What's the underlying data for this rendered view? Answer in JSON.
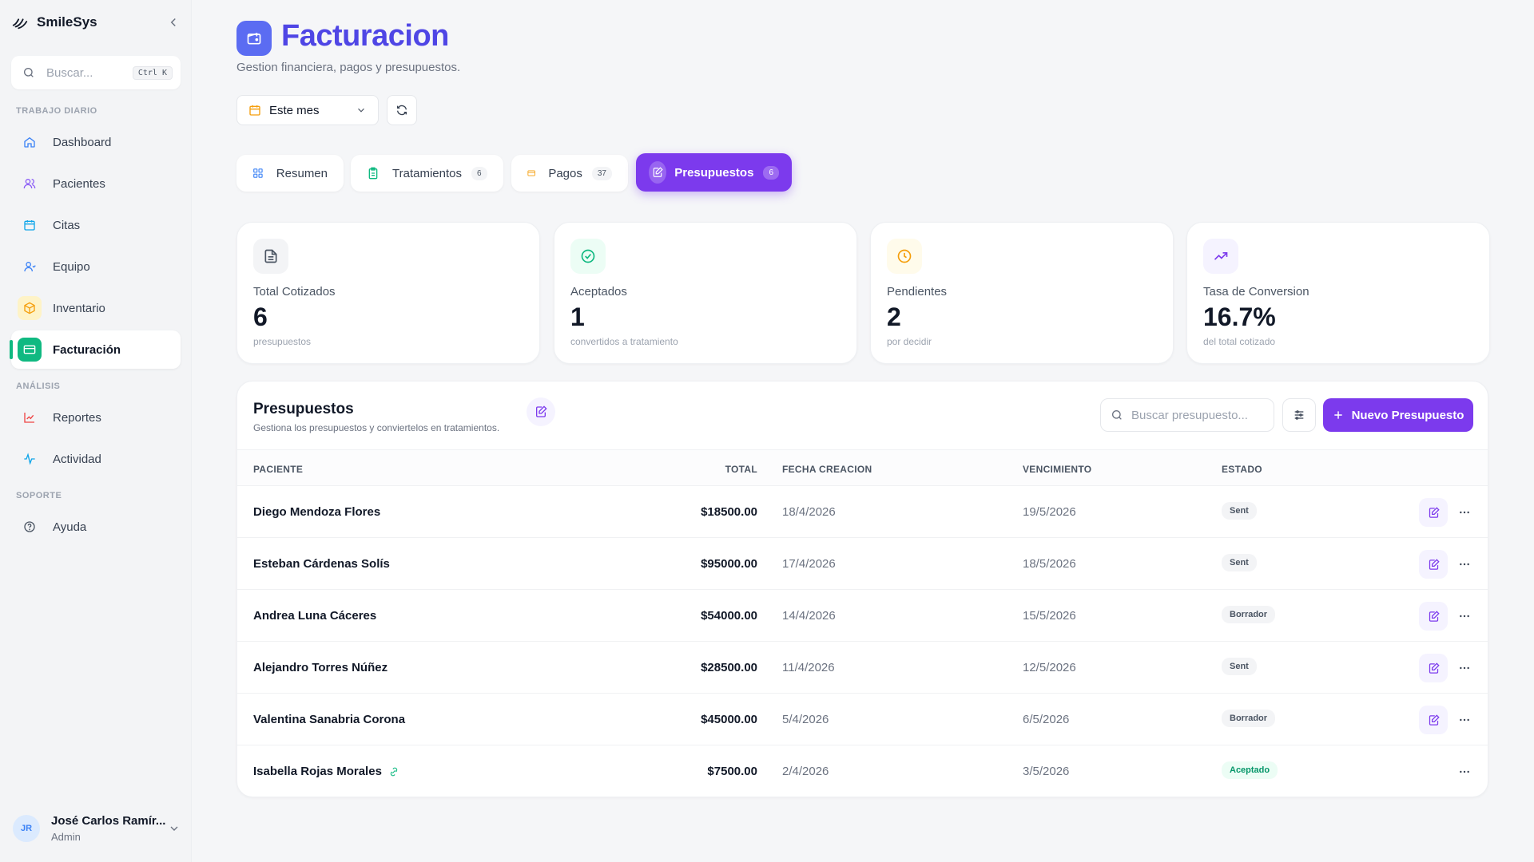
{
  "brand": {
    "name": "SmileSys"
  },
  "search": {
    "placeholder": "Buscar...",
    "shortcut": "Ctrl K"
  },
  "sidebar": {
    "sections": [
      {
        "label": "TRABAJO DIARIO"
      },
      {
        "label": "ANÁLISIS"
      },
      {
        "label": "SOPORTE"
      }
    ],
    "items": [
      {
        "label": "Dashboard",
        "icon": "home-icon",
        "color": "#3b82f6"
      },
      {
        "label": "Pacientes",
        "icon": "users-icon",
        "color": "#8b5cf6"
      },
      {
        "label": "Citas",
        "icon": "calendar-icon",
        "color": "#0ea5e9"
      },
      {
        "label": "Equipo",
        "icon": "user-icon",
        "color": "#3b82f6"
      },
      {
        "label": "Inventario",
        "icon": "box-icon",
        "color": "#f59e0b"
      },
      {
        "label": "Facturación",
        "icon": "credit-card-icon",
        "color": "#10b981"
      },
      {
        "label": "Reportes",
        "icon": "chart-icon",
        "color": "#ef4444"
      },
      {
        "label": "Actividad",
        "icon": "activity-icon",
        "color": "#0ea5e9"
      },
      {
        "label": "Ayuda",
        "icon": "help-icon",
        "color": "#6b7280"
      }
    ]
  },
  "user": {
    "initials": "JR",
    "name": "José Carlos Ramír...",
    "role": "Admin"
  },
  "header": {
    "title": "Facturacion",
    "subtitle": "Gestion financiera, pagos y presupuestos.",
    "period": "Este mes"
  },
  "tabs": [
    {
      "label": "Resumen",
      "badge": ""
    },
    {
      "label": "Tratamientos",
      "badge": "6"
    },
    {
      "label": "Pagos",
      "badge": "37"
    },
    {
      "label": "Presupuestos",
      "badge": "6"
    }
  ],
  "kpis": [
    {
      "label": "Total Cotizados",
      "value": "6",
      "sub": "presupuestos",
      "color": "#4b5563",
      "bg": "#f3f4f6"
    },
    {
      "label": "Aceptados",
      "value": "1",
      "sub": "convertidos a tratamiento",
      "color": "#10b981",
      "bg": "#ecfdf5"
    },
    {
      "label": "Pendientes",
      "value": "2",
      "sub": "por decidir",
      "color": "#f59e0b",
      "bg": "#fffbeb"
    },
    {
      "label": "Tasa de Conversion",
      "value": "16.7%",
      "sub": "del total cotizado",
      "color": "#7c3aed",
      "bg": "#f5f3ff"
    }
  ],
  "panel": {
    "title": "Presupuestos",
    "subtitle": "Gestiona los presupuestos y conviertelos en tratamientos.",
    "search_placeholder": "Buscar presupuesto...",
    "new_button": "Nuevo Presupuesto"
  },
  "table": {
    "columns": [
      "PACIENTE",
      "TOTAL",
      "FECHA CREACION",
      "VENCIMIENTO",
      "ESTADO"
    ],
    "rows": [
      {
        "patient": "Diego Mendoza Flores",
        "total": "$18500.00",
        "created": "18/4/2026",
        "due": "19/5/2026",
        "status": "Sent",
        "linked": false
      },
      {
        "patient": "Esteban Cárdenas Solís",
        "total": "$95000.00",
        "created": "17/4/2026",
        "due": "18/5/2026",
        "status": "Sent",
        "linked": false
      },
      {
        "patient": "Andrea Luna Cáceres",
        "total": "$54000.00",
        "created": "14/4/2026",
        "due": "15/5/2026",
        "status": "Borrador",
        "linked": false
      },
      {
        "patient": "Alejandro Torres Núñez",
        "total": "$28500.00",
        "created": "11/4/2026",
        "due": "12/5/2026",
        "status": "Sent",
        "linked": false
      },
      {
        "patient": "Valentina Sanabria Corona",
        "total": "$45000.00",
        "created": "5/4/2026",
        "due": "6/5/2026",
        "status": "Borrador",
        "linked": false
      },
      {
        "patient": "Isabella Rojas Morales",
        "total": "$7500.00",
        "created": "2/4/2026",
        "due": "3/5/2026",
        "status": "Aceptado",
        "linked": true
      }
    ]
  },
  "colors": {
    "accent": "#7c3aed",
    "title": "#4f46e5",
    "active_nav": "#10b981"
  }
}
